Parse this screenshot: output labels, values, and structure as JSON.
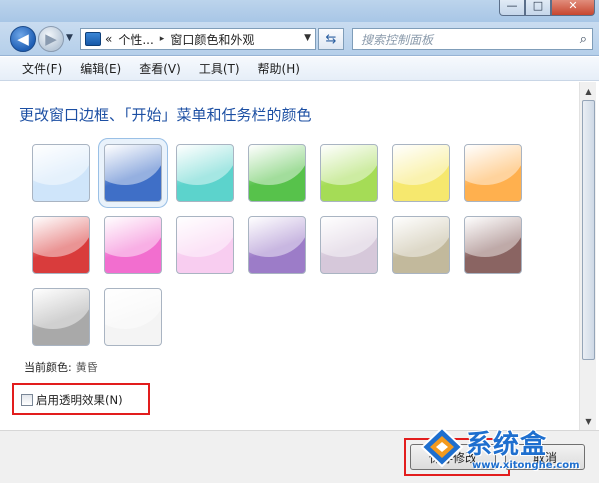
{
  "window": {
    "controls": {
      "minimize": "—",
      "maximize": "□",
      "close": "✕"
    }
  },
  "nav": {
    "back_icon": "arrow-left-icon",
    "forward_icon": "arrow-right-icon",
    "address": [
      "«",
      "个性...",
      "▸",
      "窗口颜色和外观"
    ],
    "refresh_glyph": "⇆",
    "search_placeholder": "搜索控制面板",
    "search_glyph": "⌕"
  },
  "menu": [
    "文件(F)",
    "编辑(E)",
    "查看(V)",
    "工具(T)",
    "帮助(H)"
  ],
  "main": {
    "heading": "更改窗口边框、「开始」菜单和任务栏的颜色",
    "current_label": "当前颜色:",
    "current_value": "黄昏",
    "transparency_label": "启用透明效果(N)",
    "transparency_checked": false
  },
  "swatches": [
    {
      "color": "#cfe5fa"
    },
    {
      "color": "#3f6fc7",
      "selected": true
    },
    {
      "color": "#5cd3cc"
    },
    {
      "color": "#57c24b"
    },
    {
      "color": "#a5dc56"
    },
    {
      "color": "#f6e86e"
    },
    {
      "color": "#ffb04e"
    },
    {
      "color": "#d93c3c"
    },
    {
      "color": "#f26ecf"
    },
    {
      "color": "#f8cdf0"
    },
    {
      "color": "#9c7cc8"
    },
    {
      "color": "#d6c8da"
    },
    {
      "color": "#c2b99c"
    },
    {
      "color": "#8a6462"
    },
    {
      "color": "#a9a9a9"
    },
    {
      "color": "#f4f4f4"
    }
  ],
  "buttons": {
    "save": "保存修改",
    "cancel": "取消"
  },
  "watermark": {
    "text": "系统盒",
    "url": "www.xitonghe.com"
  }
}
